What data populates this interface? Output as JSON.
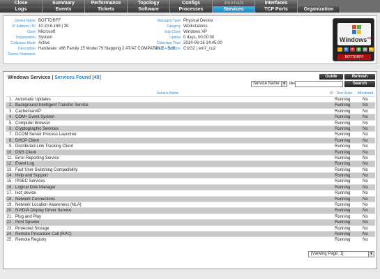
{
  "nav": {
    "row1": [
      {
        "label": "Close",
        "state": "normal"
      },
      {
        "label": "Summary",
        "state": "normal"
      },
      {
        "label": "Performance",
        "state": "normal"
      },
      {
        "label": "Topology",
        "state": "normal"
      },
      {
        "label": "Configs",
        "state": "normal"
      },
      {
        "label": "Journals",
        "state": "disabled"
      },
      {
        "label": "Interfaces",
        "state": "normal"
      }
    ],
    "row2": [
      {
        "label": "Logs",
        "state": "normal"
      },
      {
        "label": "Events",
        "state": "normal"
      },
      {
        "label": "Tickets",
        "state": "normal"
      },
      {
        "label": "Software",
        "state": "normal"
      },
      {
        "label": "Processes",
        "state": "normal"
      },
      {
        "label": "Services",
        "state": "active"
      },
      {
        "label": "TCP Ports",
        "state": "normal"
      },
      {
        "label": "Organization",
        "state": "normal"
      }
    ]
  },
  "device": {
    "left": [
      {
        "label": "Device Name",
        "value": "BOTTORFF"
      },
      {
        "label": "IP Address / ID",
        "value": "10.20.6.189 | 39"
      },
      {
        "label": "Class",
        "value": "Microsoft"
      },
      {
        "label": "Organization",
        "value": "System"
      },
      {
        "label": "Collection Mode",
        "value": "Active"
      },
      {
        "label": "Description",
        "value": "Hardware: x86 Family 15 Model 79 Stepping 2 AT/AT COMPATIBLE - Soft"
      },
      {
        "label": "Device Hostname",
        "value": ""
      }
    ],
    "right": [
      {
        "label": "Managed Type",
        "value": "Physical Device"
      },
      {
        "label": "Category",
        "value": "Workstations"
      },
      {
        "label": "Sub-Class",
        "value": "Windows XP"
      },
      {
        "label": "Uptime",
        "value": "0 days, 00:00:00"
      },
      {
        "label": "Collection Time",
        "value": "2014-06-16 14:45:00"
      },
      {
        "label": "Group / Collector",
        "value": "CUG2 | em7_cu2"
      }
    ],
    "logo_text": "Windows",
    "logo_sup": "xp",
    "card_name": "BOTTORFF"
  },
  "services": {
    "title": "Windows Services",
    "separator": " | ",
    "count_label": "Services Found [49]",
    "guide_label": "Guide",
    "refresh_label": "Refresh",
    "search_label": "Search",
    "filter_selected": "Service Name",
    "like_label": "like",
    "headers": {
      "name": "Service Name",
      "id": "ID",
      "state": "Run State",
      "monitored": "Monitored"
    },
    "rows": [
      {
        "n": "1.",
        "name": "Automatic Updates",
        "state": "Running",
        "mon": "No"
      },
      {
        "n": "2.",
        "name": "Background Intelligent Transfer Service",
        "state": "Running",
        "mon": "No"
      },
      {
        "n": "3.",
        "name": "CachemanXP",
        "state": "Running",
        "mon": "No"
      },
      {
        "n": "4.",
        "name": "COM+ Event System",
        "state": "Running",
        "mon": "No"
      },
      {
        "n": "5.",
        "name": "Computer Browser",
        "state": "Running",
        "mon": "No"
      },
      {
        "n": "6.",
        "name": "Cryptographic Services",
        "state": "Running",
        "mon": "No"
      },
      {
        "n": "7.",
        "name": "DCOM Server Process Launcher",
        "state": "Running",
        "mon": "No"
      },
      {
        "n": "8.",
        "name": "DHCP Client",
        "state": "Running",
        "mon": "No"
      },
      {
        "n": "9.",
        "name": "Distributed Link Tracking Client",
        "state": "Running",
        "mon": "No"
      },
      {
        "n": "10.",
        "name": "DNS Client",
        "state": "Running",
        "mon": "No"
      },
      {
        "n": "11.",
        "name": "Error Reporting Service",
        "state": "Running",
        "mon": "No"
      },
      {
        "n": "12.",
        "name": "Event Log",
        "state": "Running",
        "mon": "No"
      },
      {
        "n": "13.",
        "name": "Fast User Switching Compatibility",
        "state": "Running",
        "mon": "No"
      },
      {
        "n": "14.",
        "name": "Help and Support",
        "state": "Running",
        "mon": "No"
      },
      {
        "n": "15.",
        "name": "IPSEC Services",
        "state": "Running",
        "mon": "No"
      },
      {
        "n": "16.",
        "name": "Logical Disk Manager",
        "state": "Running",
        "mon": "No"
      },
      {
        "n": "17.",
        "name": "lxct_device",
        "state": "Running",
        "mon": "No"
      },
      {
        "n": "18.",
        "name": "Network Connections",
        "state": "Running",
        "mon": "No"
      },
      {
        "n": "19.",
        "name": "Network Location Awareness (NLA)",
        "state": "Running",
        "mon": "No"
      },
      {
        "n": "20.",
        "name": "NVIDIA Display Driver Service",
        "state": "Running",
        "mon": "No"
      },
      {
        "n": "21.",
        "name": "Plug and Play",
        "state": "Running",
        "mon": "No"
      },
      {
        "n": "22.",
        "name": "Print Spooler",
        "state": "Running",
        "mon": "No"
      },
      {
        "n": "23.",
        "name": "Protected Storage",
        "state": "Running",
        "mon": "No"
      },
      {
        "n": "24.",
        "name": "Remote Procedure Call (RPC)",
        "state": "Running",
        "mon": "No"
      },
      {
        "n": "25.",
        "name": "Remote Registry",
        "state": "Running",
        "mon": "No"
      }
    ],
    "pager_label": "[Viewing Page: 1]"
  },
  "colors": {
    "accent": "#1b86c8",
    "label_blue": "#3b88c4",
    "row_alt": "#c9c9c9"
  }
}
